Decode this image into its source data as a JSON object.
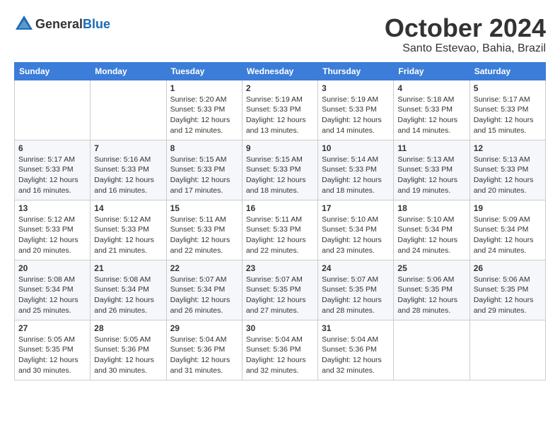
{
  "logo": {
    "general": "General",
    "blue": "Blue"
  },
  "header": {
    "month": "October 2024",
    "location": "Santo Estevao, Bahia, Brazil"
  },
  "weekdays": [
    "Sunday",
    "Monday",
    "Tuesday",
    "Wednesday",
    "Thursday",
    "Friday",
    "Saturday"
  ],
  "weeks": [
    [
      {
        "day": "",
        "info": ""
      },
      {
        "day": "",
        "info": ""
      },
      {
        "day": "1",
        "info": "Sunrise: 5:20 AM\nSunset: 5:33 PM\nDaylight: 12 hours and 12 minutes."
      },
      {
        "day": "2",
        "info": "Sunrise: 5:19 AM\nSunset: 5:33 PM\nDaylight: 12 hours and 13 minutes."
      },
      {
        "day": "3",
        "info": "Sunrise: 5:19 AM\nSunset: 5:33 PM\nDaylight: 12 hours and 14 minutes."
      },
      {
        "day": "4",
        "info": "Sunrise: 5:18 AM\nSunset: 5:33 PM\nDaylight: 12 hours and 14 minutes."
      },
      {
        "day": "5",
        "info": "Sunrise: 5:17 AM\nSunset: 5:33 PM\nDaylight: 12 hours and 15 minutes."
      }
    ],
    [
      {
        "day": "6",
        "info": "Sunrise: 5:17 AM\nSunset: 5:33 PM\nDaylight: 12 hours and 16 minutes."
      },
      {
        "day": "7",
        "info": "Sunrise: 5:16 AM\nSunset: 5:33 PM\nDaylight: 12 hours and 16 minutes."
      },
      {
        "day": "8",
        "info": "Sunrise: 5:15 AM\nSunset: 5:33 PM\nDaylight: 12 hours and 17 minutes."
      },
      {
        "day": "9",
        "info": "Sunrise: 5:15 AM\nSunset: 5:33 PM\nDaylight: 12 hours and 18 minutes."
      },
      {
        "day": "10",
        "info": "Sunrise: 5:14 AM\nSunset: 5:33 PM\nDaylight: 12 hours and 18 minutes."
      },
      {
        "day": "11",
        "info": "Sunrise: 5:13 AM\nSunset: 5:33 PM\nDaylight: 12 hours and 19 minutes."
      },
      {
        "day": "12",
        "info": "Sunrise: 5:13 AM\nSunset: 5:33 PM\nDaylight: 12 hours and 20 minutes."
      }
    ],
    [
      {
        "day": "13",
        "info": "Sunrise: 5:12 AM\nSunset: 5:33 PM\nDaylight: 12 hours and 20 minutes."
      },
      {
        "day": "14",
        "info": "Sunrise: 5:12 AM\nSunset: 5:33 PM\nDaylight: 12 hours and 21 minutes."
      },
      {
        "day": "15",
        "info": "Sunrise: 5:11 AM\nSunset: 5:33 PM\nDaylight: 12 hours and 22 minutes."
      },
      {
        "day": "16",
        "info": "Sunrise: 5:11 AM\nSunset: 5:33 PM\nDaylight: 12 hours and 22 minutes."
      },
      {
        "day": "17",
        "info": "Sunrise: 5:10 AM\nSunset: 5:34 PM\nDaylight: 12 hours and 23 minutes."
      },
      {
        "day": "18",
        "info": "Sunrise: 5:10 AM\nSunset: 5:34 PM\nDaylight: 12 hours and 24 minutes."
      },
      {
        "day": "19",
        "info": "Sunrise: 5:09 AM\nSunset: 5:34 PM\nDaylight: 12 hours and 24 minutes."
      }
    ],
    [
      {
        "day": "20",
        "info": "Sunrise: 5:08 AM\nSunset: 5:34 PM\nDaylight: 12 hours and 25 minutes."
      },
      {
        "day": "21",
        "info": "Sunrise: 5:08 AM\nSunset: 5:34 PM\nDaylight: 12 hours and 26 minutes."
      },
      {
        "day": "22",
        "info": "Sunrise: 5:07 AM\nSunset: 5:34 PM\nDaylight: 12 hours and 26 minutes."
      },
      {
        "day": "23",
        "info": "Sunrise: 5:07 AM\nSunset: 5:35 PM\nDaylight: 12 hours and 27 minutes."
      },
      {
        "day": "24",
        "info": "Sunrise: 5:07 AM\nSunset: 5:35 PM\nDaylight: 12 hours and 28 minutes."
      },
      {
        "day": "25",
        "info": "Sunrise: 5:06 AM\nSunset: 5:35 PM\nDaylight: 12 hours and 28 minutes."
      },
      {
        "day": "26",
        "info": "Sunrise: 5:06 AM\nSunset: 5:35 PM\nDaylight: 12 hours and 29 minutes."
      }
    ],
    [
      {
        "day": "27",
        "info": "Sunrise: 5:05 AM\nSunset: 5:35 PM\nDaylight: 12 hours and 30 minutes."
      },
      {
        "day": "28",
        "info": "Sunrise: 5:05 AM\nSunset: 5:36 PM\nDaylight: 12 hours and 30 minutes."
      },
      {
        "day": "29",
        "info": "Sunrise: 5:04 AM\nSunset: 5:36 PM\nDaylight: 12 hours and 31 minutes."
      },
      {
        "day": "30",
        "info": "Sunrise: 5:04 AM\nSunset: 5:36 PM\nDaylight: 12 hours and 32 minutes."
      },
      {
        "day": "31",
        "info": "Sunrise: 5:04 AM\nSunset: 5:36 PM\nDaylight: 12 hours and 32 minutes."
      },
      {
        "day": "",
        "info": ""
      },
      {
        "day": "",
        "info": ""
      }
    ]
  ]
}
